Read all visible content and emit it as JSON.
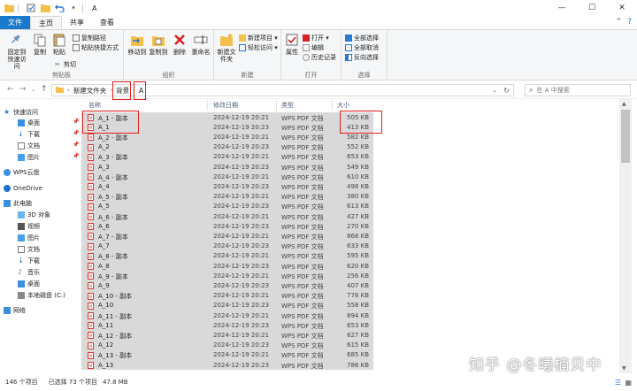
{
  "window": {
    "title": "A"
  },
  "ribbon_tabs": [
    "文件",
    "主页",
    "共享",
    "查看"
  ],
  "ribbon": {
    "clipboard": {
      "group_label": "剪贴板",
      "pin_label": "固定到快速访问",
      "copy_label": "复制",
      "paste_label": "粘贴",
      "copy_path_label": "复制路径",
      "paste_shortcut_label": "粘贴快捷方式",
      "cut_label": "剪切"
    },
    "organize": {
      "group_label": "组织",
      "move_to_label": "移动到",
      "copy_to_label": "复制到",
      "delete_label": "删除",
      "rename_label": "重命名"
    },
    "new": {
      "group_label": "新建",
      "new_folder_label": "新建文件夹",
      "new_item_label": "新建项目",
      "easy_access_label": "轻松访问"
    },
    "open": {
      "group_label": "打开",
      "properties_label": "属性",
      "open_label": "打开",
      "edit_label": "编辑",
      "history_label": "历史记录"
    },
    "select": {
      "group_label": "选择",
      "select_all_label": "全部选择",
      "select_none_label": "全部取消",
      "invert_label": "反向选择"
    }
  },
  "address": {
    "crumbs": [
      "新建文件夹",
      "背景",
      "A"
    ],
    "search_placeholder": "在 A 中搜索"
  },
  "nav": {
    "quick_access": "快速访问",
    "quick_items": [
      "桌面",
      "下载",
      "文档",
      "图片"
    ],
    "wps": "WPS云盘",
    "onedrive": "OneDrive",
    "this_pc": "此电脑",
    "pc_items": [
      "3D 对象",
      "视频",
      "图片",
      "文档",
      "下载",
      "音乐",
      "桌面",
      "本地磁盘 (C:)"
    ],
    "network": "网络"
  },
  "columns": {
    "name": "名称",
    "date": "修改日期",
    "type": "类型",
    "size": "大小"
  },
  "files": [
    {
      "name": "A_1 - 副本",
      "date": "2024-12-19 20:21",
      "type": "WPS PDF 文档",
      "size": "505 KB"
    },
    {
      "name": "A_1",
      "date": "2024-12-19 20:23",
      "type": "WPS PDF 文档",
      "size": "413 KB"
    },
    {
      "name": "A_2 - 副本",
      "date": "2024-12-19 20:21",
      "type": "WPS PDF 文档",
      "size": "582 KB"
    },
    {
      "name": "A_2",
      "date": "2024-12-19 20:23",
      "type": "WPS PDF 文档",
      "size": "552 KB"
    },
    {
      "name": "A_3 - 副本",
      "date": "2024-12-19 20:21",
      "type": "WPS PDF 文档",
      "size": "653 KB"
    },
    {
      "name": "A_3",
      "date": "2024-12-19 20:23",
      "type": "WPS PDF 文档",
      "size": "549 KB"
    },
    {
      "name": "A_4 - 副本",
      "date": "2024-12-19 20:21",
      "type": "WPS PDF 文档",
      "size": "610 KB"
    },
    {
      "name": "A_4",
      "date": "2024-12-19 20:23",
      "type": "WPS PDF 文档",
      "size": "498 KB"
    },
    {
      "name": "A_5 - 副本",
      "date": "2024-12-19 20:21",
      "type": "WPS PDF 文档",
      "size": "380 KB"
    },
    {
      "name": "A_5",
      "date": "2024-12-19 20:23",
      "type": "WPS PDF 文档",
      "size": "613 KB"
    },
    {
      "name": "A_6 - 副本",
      "date": "2024-12-19 20:21",
      "type": "WPS PDF 文档",
      "size": "427 KB"
    },
    {
      "name": "A_6",
      "date": "2024-12-19 20:23",
      "type": "WPS PDF 文档",
      "size": "270 KB"
    },
    {
      "name": "A_7 - 副本",
      "date": "2024-12-19 20:21",
      "type": "WPS PDF 文档",
      "size": "868 KB"
    },
    {
      "name": "A_7",
      "date": "2024-12-19 20:23",
      "type": "WPS PDF 文档",
      "size": "633 KB"
    },
    {
      "name": "A_8 - 副本",
      "date": "2024-12-19 20:21",
      "type": "WPS PDF 文档",
      "size": "595 KB"
    },
    {
      "name": "A_8",
      "date": "2024-12-19 20:23",
      "type": "WPS PDF 文档",
      "size": "620 KB"
    },
    {
      "name": "A_9 - 副本",
      "date": "2024-12-19 20:21",
      "type": "WPS PDF 文档",
      "size": "256 KB"
    },
    {
      "name": "A_9",
      "date": "2024-12-19 20:23",
      "type": "WPS PDF 文档",
      "size": "407 KB"
    },
    {
      "name": "A_10 - 副本",
      "date": "2024-12-19 20:21",
      "type": "WPS PDF 文档",
      "size": "778 KB"
    },
    {
      "name": "A_10",
      "date": "2024-12-19 20:23",
      "type": "WPS PDF 文档",
      "size": "558 KB"
    },
    {
      "name": "A_11 - 副本",
      "date": "2024-12-19 20:21",
      "type": "WPS PDF 文档",
      "size": "894 KB"
    },
    {
      "name": "A_11",
      "date": "2024-12-19 20:23",
      "type": "WPS PDF 文档",
      "size": "653 KB"
    },
    {
      "name": "A_12 - 副本",
      "date": "2024-12-19 20:21",
      "type": "WPS PDF 文档",
      "size": "827 KB"
    },
    {
      "name": "A_12",
      "date": "2024-12-19 20:23",
      "type": "WPS PDF 文档",
      "size": "615 KB"
    },
    {
      "name": "A_13 - 副本",
      "date": "2024-12-19 20:21",
      "type": "WPS PDF 文档",
      "size": "685 KB"
    },
    {
      "name": "A_13",
      "date": "2024-12-19 20:23",
      "type": "WPS PDF 文档",
      "size": "786 KB"
    }
  ],
  "status": {
    "count": "146 个项目",
    "selected": "已选择 73 个项目",
    "size": "47.8 MB"
  },
  "watermark": "知乎 @冬曦楠贝中"
}
